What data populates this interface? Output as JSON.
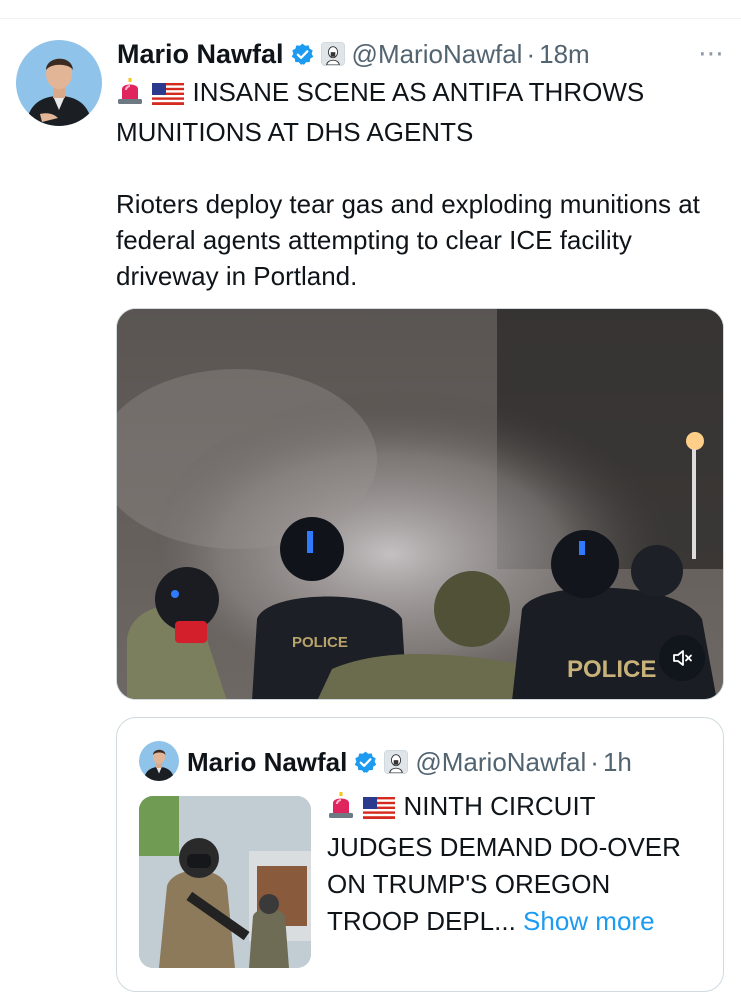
{
  "tweet": {
    "author": {
      "display_name": "Mario Nawfal",
      "handle": "@MarioNawfal",
      "verified": true,
      "verified_color": "#1d9bf0"
    },
    "time": "18m",
    "separator": "·",
    "more_icon": "⋯",
    "headline": "INSANE SCENE AS ANTIFA THROWS MUNITIONS AT DHS AGENTS",
    "headline_emojis": [
      "siren-emoji",
      "us-flag-emoji"
    ],
    "body": "Rioters deploy tear gas and exploding munitions at federal agents attempting to clear ICE facility driveway in Portland.",
    "media": {
      "type": "video",
      "visible_text": [
        "POLICE",
        "POLICE"
      ],
      "muted": true
    }
  },
  "quoted": {
    "author": {
      "display_name": "Mario Nawfal",
      "handle": "@MarioNawfal",
      "verified": true
    },
    "time": "1h",
    "separator": "·",
    "text": "NINTH CIRCUIT JUDGES DEMAND DO-OVER ON TRUMP'S OREGON TROOP DEPL...",
    "text_emojis": [
      "siren-emoji",
      "us-flag-emoji"
    ],
    "show_more": "Show more"
  },
  "colors": {
    "link": "#1d9bf0",
    "secondary_text": "#536471",
    "border": "#cfd9de"
  }
}
